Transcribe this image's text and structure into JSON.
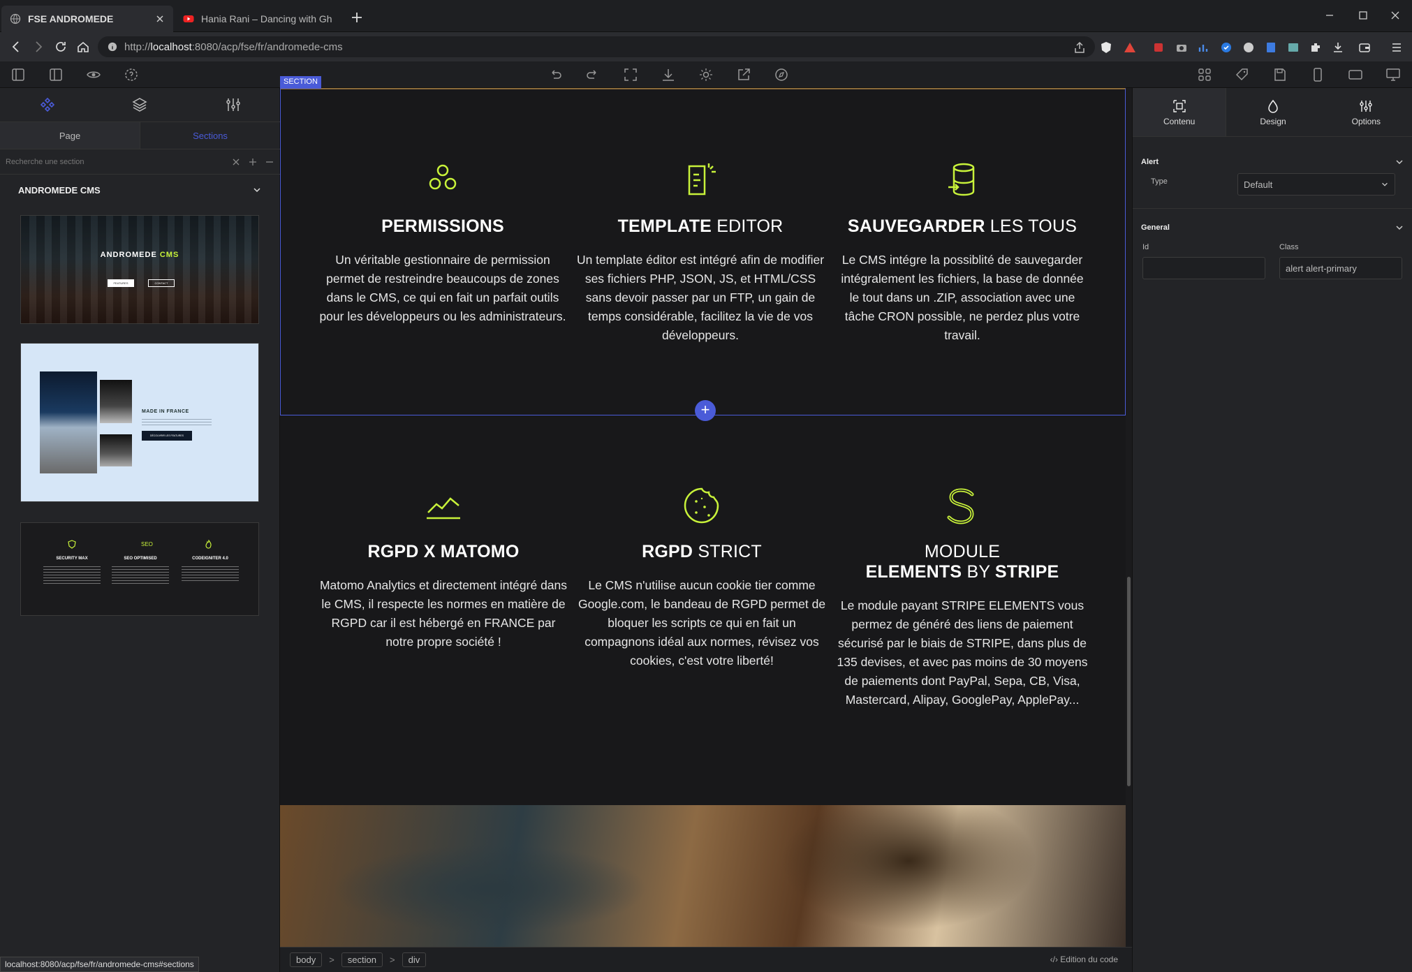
{
  "browser": {
    "tabs": [
      {
        "title": "FSE ANDROMEDE",
        "active": true
      },
      {
        "title": "Hania Rani – Dancing with Ghosts ft. P",
        "active": false
      }
    ],
    "url_prefix": "http://",
    "url_host": "localhost",
    "url_rest": ":8080/acp/fse/fr/andromede-cms",
    "status_url": "localhost:8080/acp/fse/fr/andromede-cms#sections"
  },
  "left_panel": {
    "subtabs": {
      "page": "Page",
      "sections": "Sections"
    },
    "search_placeholder": "Recherche une section",
    "group_title": "ANDROMEDE CMS",
    "thumbnails": {
      "thumb1": {
        "title_a": "ANDROMEDE",
        "title_b": "CMS",
        "btn1": "FEATURES",
        "btn2": "CONTACT"
      },
      "thumb2": {
        "title": "MADE IN FRANCE",
        "btn": "DÉCOUVRIR LES FEATURES"
      },
      "thumb3": {
        "col1": "SECURITY MAX",
        "col2": "SEO OPTIMISED",
        "col3": "CODEIGNITER 4.0",
        "col2_icon_label": "SEO"
      }
    }
  },
  "canvas": {
    "section_label": "SECTION",
    "features": [
      {
        "title_bold": "PERMISSIONS",
        "title_light": "",
        "text": "Un véritable gestionnaire de permission permet de restreindre beaucoups de zones dans le CMS, ce qui en fait un parfait outils pour les développeurs ou les administrateurs."
      },
      {
        "title_bold": "TEMPLATE",
        "title_light": "EDITOR",
        "text": "Un template éditor est intégré afin de modifier ses fichiers PHP, JSON, JS, et HTML/CSS sans devoir passer par un FTP, un gain de temps considérable, facilitez la vie de vos développeurs."
      },
      {
        "title_bold": "SAUVEGARDER",
        "title_light": "LES TOUS",
        "text": "Le CMS intégre la possiblité de sauvegarder intégralement les fichiers, la base de donnée le tout dans un .ZIP, association avec une tâche CRON possible, ne perdez plus votre travail."
      },
      {
        "title_bold": "RGPD X MATOMO",
        "title_light": "",
        "text": "Matomo Analytics et directement intégré dans le CMS, il respecte les normes en matière de RGPD car il est hébergé en FRANCE par notre propre société !"
      },
      {
        "title_bold": "RGPD",
        "title_light": "STRICT",
        "text": "Le CMS n'utilise aucun cookie tier comme Google.com, le bandeau de RGPD permet de bloquer les scripts ce qui en fait un compagnons idéal aux normes, révisez vos cookies, c'est votre liberté!"
      },
      {
        "title_light_top": "MODULE",
        "title_bold": "ELEMENTS",
        "title_light": "BY",
        "title_bold2": "STRIPE",
        "text": "Le module payant STRIPE ELEMENTS vous permez de généré des liens de paiement sécurisé par le biais de STRIPE, dans plus de 135 devises, et avec pas moins de 30 moyens de paiements dont PayPal, Sepa, CB, Visa, Mastercard, Alipay, GooglePay, ApplePay..."
      }
    ],
    "accent_color": "#c8f23a"
  },
  "breadcrumb": {
    "items": [
      "body",
      "section",
      "div"
    ],
    "separator": ">",
    "code_edit": "‹/› Edition du code"
  },
  "right_panel": {
    "tabs": {
      "contenu": "Contenu",
      "design": "Design",
      "options": "Options"
    },
    "alert_section": "Alert",
    "type_label": "Type",
    "type_value": "Default",
    "general_section": "General",
    "id_label": "Id",
    "id_value": "",
    "class_label": "Class",
    "class_value": "alert alert-primary"
  }
}
